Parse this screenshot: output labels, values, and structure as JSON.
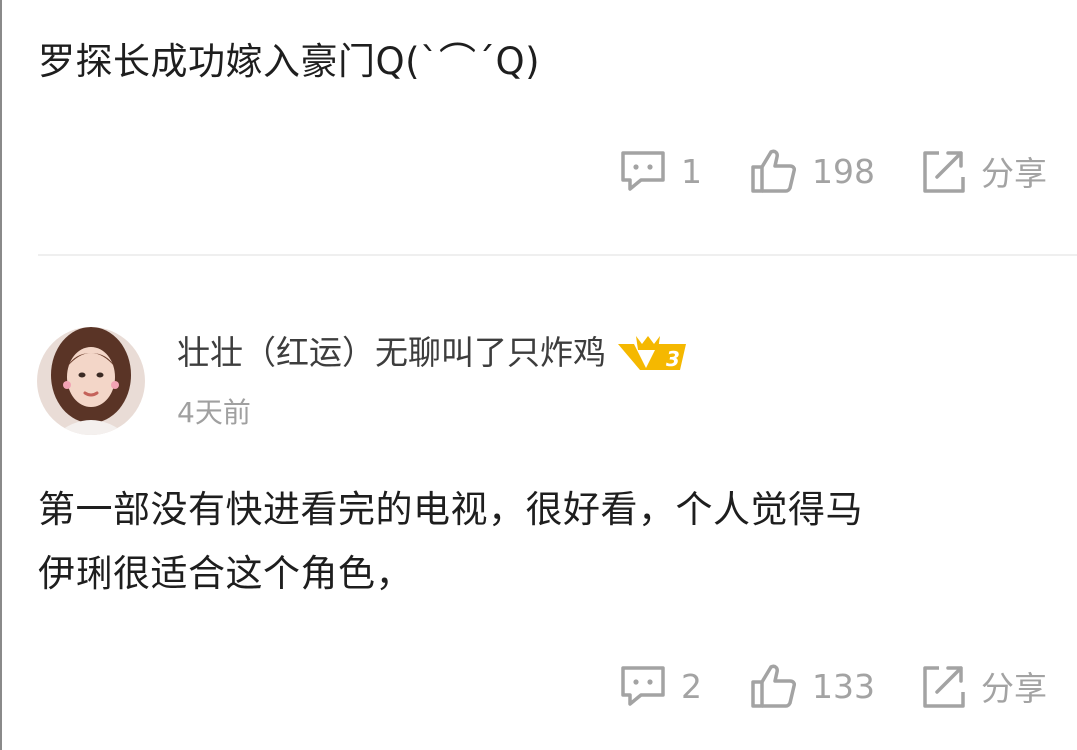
{
  "comments": [
    {
      "text": "罗探长成功嫁入豪门Q(`⌒´Q)",
      "reply_count": "1",
      "like_count": "198",
      "share_label": "分享"
    },
    {
      "username": "壮壮（红运）无聊叫了只炸鸡",
      "vip_level": "3",
      "timestamp": "4天前",
      "text": "第一部没有快进看完的电视，很好看，个人觉得马\n伊琍很适合这个角色，",
      "reply_count": "2",
      "like_count": "133",
      "share_label": "分享"
    }
  ],
  "colors": {
    "text": "#1e1e1e",
    "meta": "#a3a3a3",
    "username": "#3d3d3d",
    "vip_gold": "#f5b800",
    "divider": "#efefef"
  },
  "icons": [
    "comment-icon",
    "thumbs-up-icon",
    "share-icon",
    "vip-badge-icon"
  ]
}
